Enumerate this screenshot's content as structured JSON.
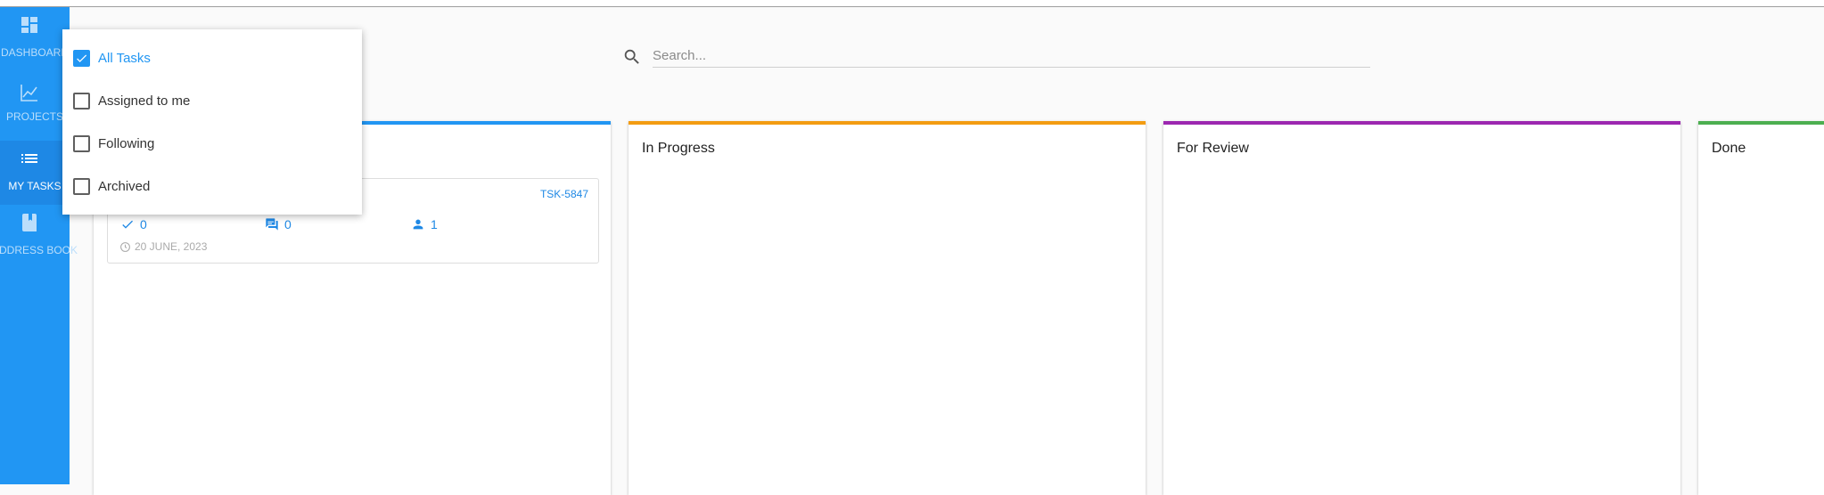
{
  "colors": {
    "accent": "#2196f3",
    "sidebar_active": "#1e88e5",
    "in_progress": "#f39c12",
    "for_review": "#9c27b0",
    "done": "#4caf50"
  },
  "sidebar": {
    "items": [
      {
        "label": "DASHBOARD",
        "icon": "dashboard-icon",
        "active": false
      },
      {
        "label": "PROJECTS",
        "icon": "chart-line-icon",
        "active": false
      },
      {
        "label": "MY TASKS",
        "icon": "list-icon",
        "active": true
      },
      {
        "label": "ADDRESS BOOK",
        "icon": "book-icon",
        "active": false
      }
    ]
  },
  "search": {
    "placeholder": "Search...",
    "value": ""
  },
  "filter_menu": {
    "items": [
      {
        "label": "All Tasks",
        "checked": true
      },
      {
        "label": "Assigned to me",
        "checked": false
      },
      {
        "label": "Following",
        "checked": false
      },
      {
        "label": "Archived",
        "checked": false
      }
    ]
  },
  "columns": [
    {
      "title": "",
      "color": "#2196f3"
    },
    {
      "title": "In Progress",
      "color": "#f39c12"
    },
    {
      "title": "For Review",
      "color": "#9c27b0"
    },
    {
      "title": "Done",
      "color": "#4caf50"
    }
  ],
  "task_card": {
    "id": "TSK-5847",
    "checks": "0",
    "comments": "0",
    "assignees": "1",
    "date": "20 JUNE, 2023"
  }
}
